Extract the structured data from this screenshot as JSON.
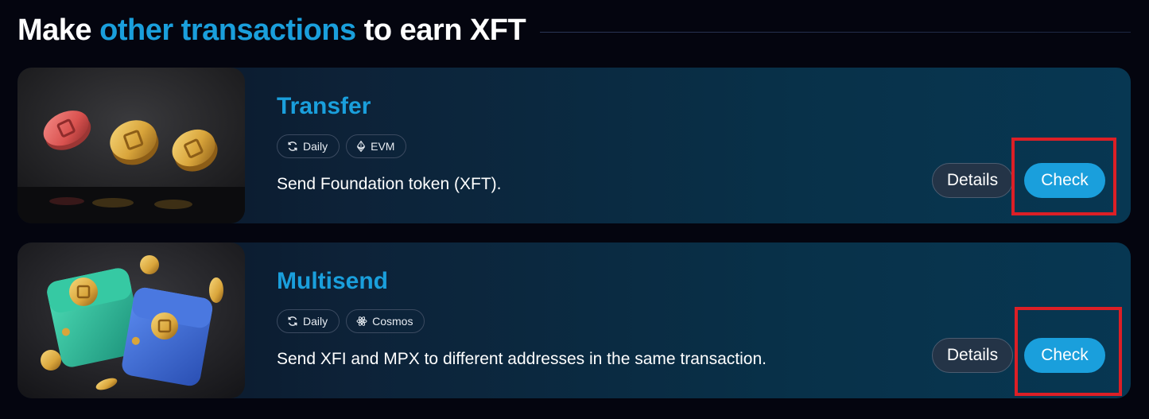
{
  "heading": {
    "prefix": "Make ",
    "accent": "other transactions",
    "suffix": " to earn XFT"
  },
  "colors": {
    "accent": "#1a9fdc",
    "background": "#04050f",
    "highlight": "#dc1f26"
  },
  "tasks": [
    {
      "title": "Transfer",
      "image_icon": "coins-illustration",
      "tags": [
        {
          "icon": "refresh-icon",
          "label": "Daily"
        },
        {
          "icon": "ethereum-icon",
          "label": "EVM"
        }
      ],
      "description": "Send Foundation token (XFT).",
      "details_label": "Details",
      "check_label": "Check"
    },
    {
      "title": "Multisend",
      "image_icon": "wallets-illustration",
      "tags": [
        {
          "icon": "refresh-icon",
          "label": "Daily"
        },
        {
          "icon": "cosmos-icon",
          "label": "Cosmos"
        }
      ],
      "description": "Send XFI and MPX to different addresses in the same transaction.",
      "details_label": "Details",
      "check_label": "Check"
    }
  ]
}
